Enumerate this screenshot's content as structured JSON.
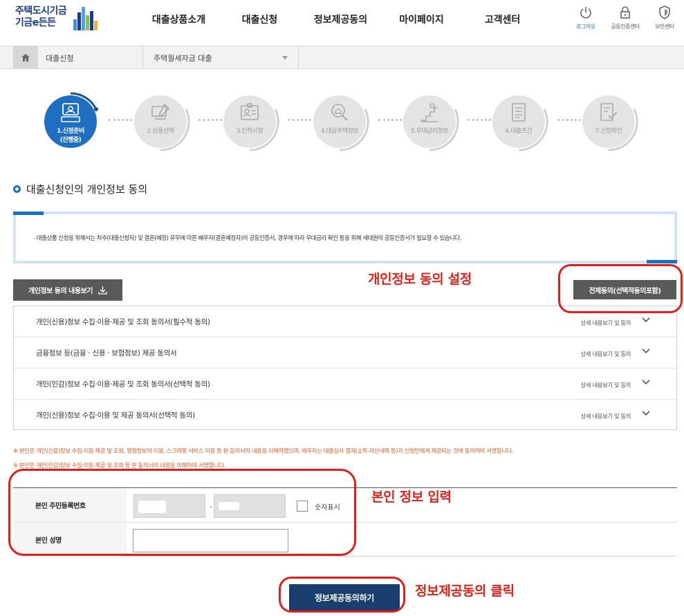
{
  "header": {
    "logo_line1": "주택도시기금",
    "logo_line2": "기금e든든",
    "nav": [
      "대출상품소개",
      "대출신청",
      "정보제공동의",
      "마이페이지",
      "고객센터"
    ],
    "util": [
      {
        "label": "로그아웃",
        "icon": "power-icon"
      },
      {
        "label": "공동인증센터",
        "icon": "lock-icon"
      },
      {
        "label": "보안센터",
        "icon": "shield-icon"
      }
    ]
  },
  "breadcrumb": {
    "current": "대출신청",
    "product": "주택월세자금 대출"
  },
  "steps": [
    {
      "label": "1.신청준비",
      "sub": "(진행중)"
    },
    {
      "label": "2.상품선택",
      "sub": ""
    },
    {
      "label": "3.인적사항",
      "sub": ""
    },
    {
      "label": "4.대상주택정보",
      "sub": ""
    },
    {
      "label": "5.우대금리정보",
      "sub": ""
    },
    {
      "label": "6.대출조건",
      "sub": ""
    },
    {
      "label": "7.신청확인",
      "sub": ""
    }
  ],
  "section": {
    "title": "대출신청인의 개인정보 동의",
    "notice": "- 대출상품 신청을 위해서는 차주(대출신청자) 및 결혼(예정) 유무에 따른 배우자(결혼예정자)의 공동인증서, 경우에 따라 우대금리 확인 등을 위해 세대원의 공동인증서가 필요할 수 있습니다."
  },
  "buttons": {
    "view_consent": "개인정보 동의 내용보기",
    "agree_all": "전체동의(선택적동의포함)",
    "submit": "정보제공동의하기"
  },
  "consents": [
    {
      "title": "개인(신용)정보 수집·이용·제공 및 조회 동의서(필수적 동의)",
      "detail": "상세 내용보기 및 동의"
    },
    {
      "title": "금융정보 등(금융 · 신용 · 보험정보) 제공 동의서",
      "detail": "상세 내용보기 및 동의"
    },
    {
      "title": "개인(민감)정보 수집·이용·제공 및 조회 동의서(선택적 동의)",
      "detail": "상세 내용보기 및 동의"
    },
    {
      "title": "개인(신용)정보 수집·이용 및 제공 동의서(선택적 동의)",
      "detail": "상세 내용보기 및 동의"
    }
  ],
  "warnings": {
    "w1": "※ 본인은 개인(신용)정보 수집·이용·제공 및 조회, 행정정보의 이용, 스크래핑 서비스 이용 등 본 동의서의 내용을 이해하였으며, 배우자는 대출심사 결과(소득·자산내역 등)가 신청인에게 제공되는 것에 동의하여 서명합니다.",
    "w2": "※ 본인은 개인(민감)정보 수집·이용·제공 및 조회 등 본 동의서의 내용을 이해하여 서명합니다."
  },
  "identity": {
    "ssn_label": "본인 주민등록번호",
    "ssn_dash": "-",
    "show_digits": "숫자표시",
    "name_label": "본인 성명"
  },
  "annotations": {
    "consent_setting": "개인정보 동의 설정",
    "identity_input": "본인 정보 입력",
    "submit_click": "정보제공동의 클릭"
  },
  "colors": {
    "primary": "#1e6fc1",
    "submit_bg": "#173e6d",
    "annotation": "#e0211c",
    "warning": "#e2602d"
  }
}
